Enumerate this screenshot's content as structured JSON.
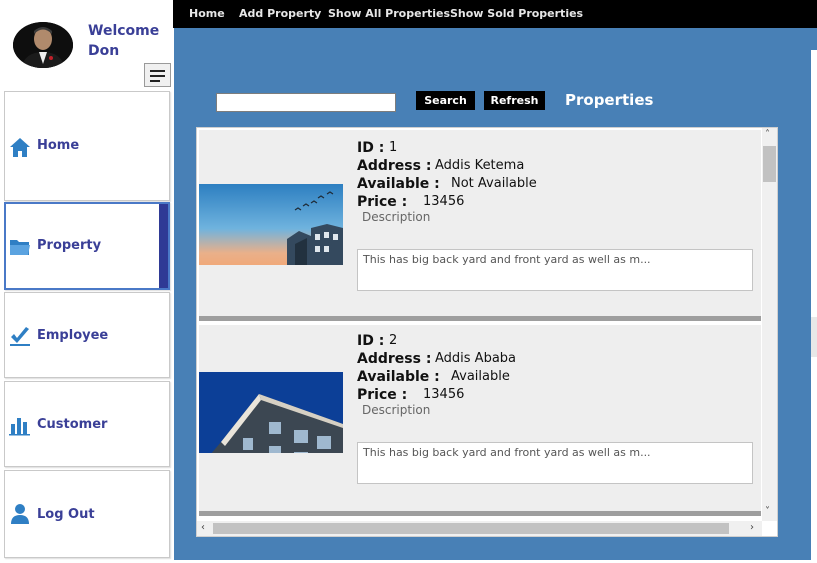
{
  "sidebar": {
    "welcome_line1": "Welcome",
    "welcome_line2": "Don",
    "items": [
      {
        "label": "Home",
        "icon": "home-icon"
      },
      {
        "label": "Property",
        "icon": "folder-icon"
      },
      {
        "label": "Employee",
        "icon": "checkmark-icon"
      },
      {
        "label": "Customer",
        "icon": "bar-chart-icon"
      },
      {
        "label": "Log Out",
        "icon": "user-icon"
      }
    ]
  },
  "topnav": {
    "links": [
      "Home",
      "Add Property",
      "Show All Properties",
      "Show Sold Properties"
    ]
  },
  "toolbar": {
    "search_value": "",
    "search_label": "Search",
    "refresh_label": "Refresh",
    "title": "Properties"
  },
  "properties": [
    {
      "id_label": "ID :",
      "id": "1",
      "address_label": "Address :",
      "address": "Addis Ketema",
      "available_label": "Available :",
      "available": "Not Available",
      "price_label": "Price :",
      "price": "13456",
      "description_label": "Description",
      "description": "This has big back yard and front yard as well as m..."
    },
    {
      "id_label": "ID :",
      "id": "2",
      "address_label": "Address :",
      "address": "Addis Ababa",
      "available_label": "Available :",
      "available": "Available",
      "price_label": "Price :",
      "price": "13456",
      "description_label": "Description",
      "description": "This has big back yard and front yard as well as m..."
    }
  ],
  "colors": {
    "main_bg": "#4880b6",
    "nav_text": "#3a3f97",
    "active_accent": "#2f3a95",
    "topbar_bg": "#000000"
  }
}
